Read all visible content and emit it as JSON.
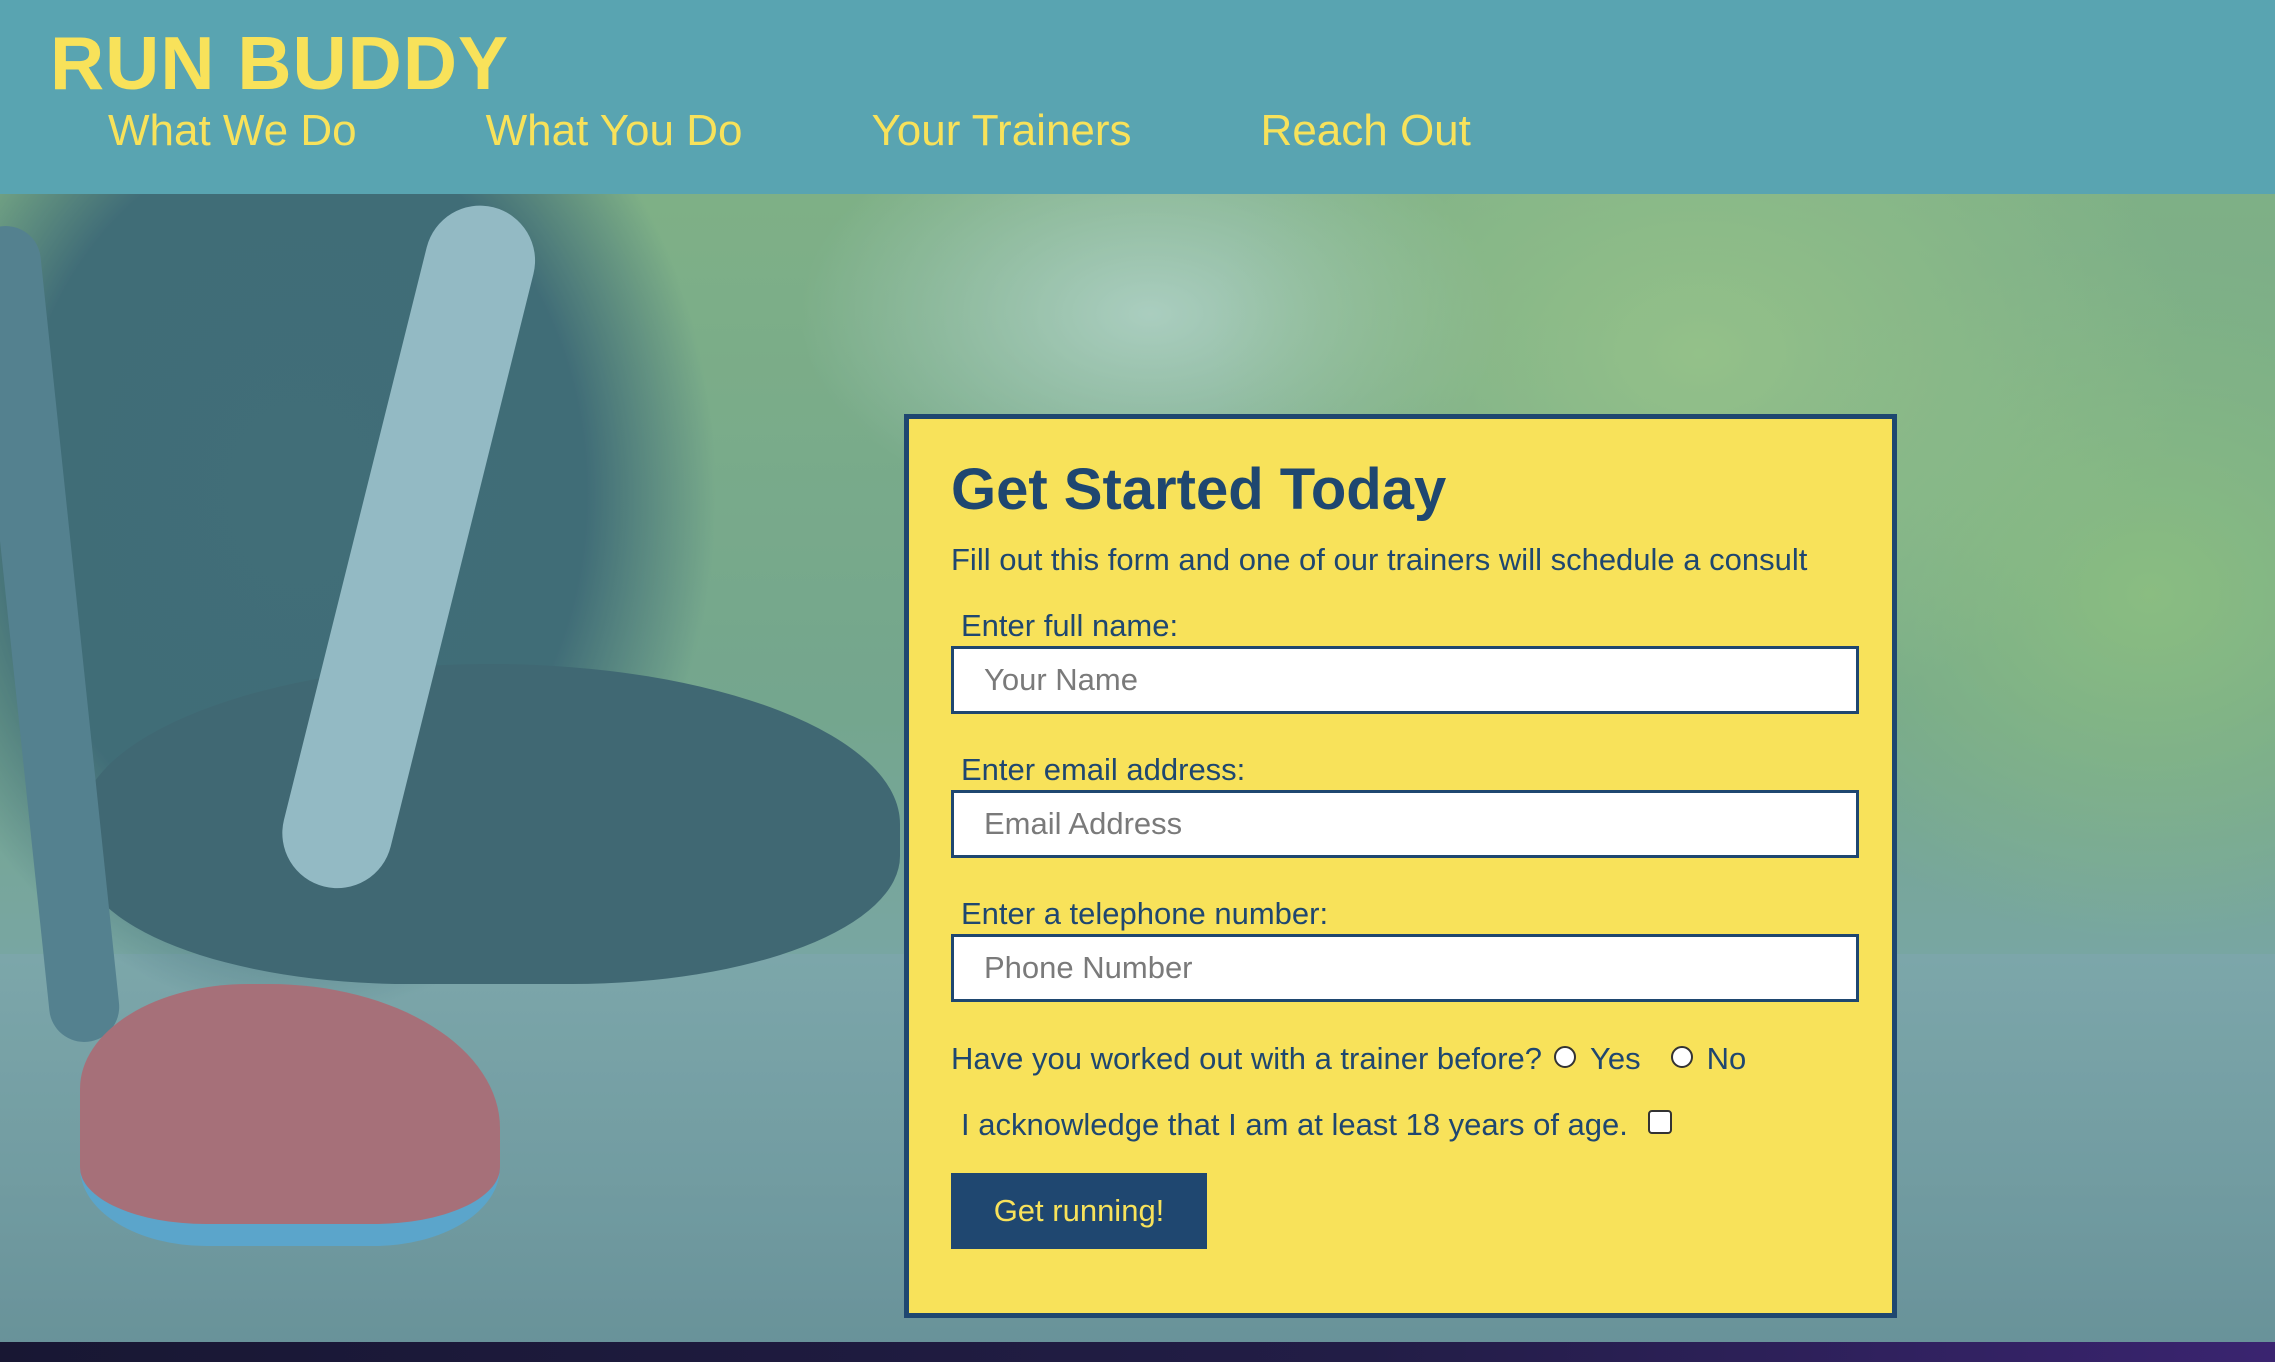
{
  "header": {
    "brand": "RUN BUDDY",
    "nav": [
      {
        "label": "What We Do"
      },
      {
        "label": "What You Do"
      },
      {
        "label": "Your Trainers"
      },
      {
        "label": "Reach Out"
      }
    ]
  },
  "form": {
    "title": "Get Started Today",
    "subtitle": "Fill out this form and one of our trainers will schedule a consult",
    "name_label": "Enter full name:",
    "name_placeholder": "Your Name",
    "email_label": "Enter email address:",
    "email_placeholder": "Email Address",
    "phone_label": "Enter a telephone number:",
    "phone_placeholder": "Phone Number",
    "trainer_question": "Have you worked out with a trainer before?",
    "trainer_yes": "Yes",
    "trainer_no": "No",
    "age_ack": "I acknowledge that I am at least 18 years of age.",
    "submit_label": "Get running!"
  },
  "colors": {
    "header_bg": "#59a4b1",
    "accent_yellow": "#f8e25a",
    "navy": "#1f4770"
  }
}
